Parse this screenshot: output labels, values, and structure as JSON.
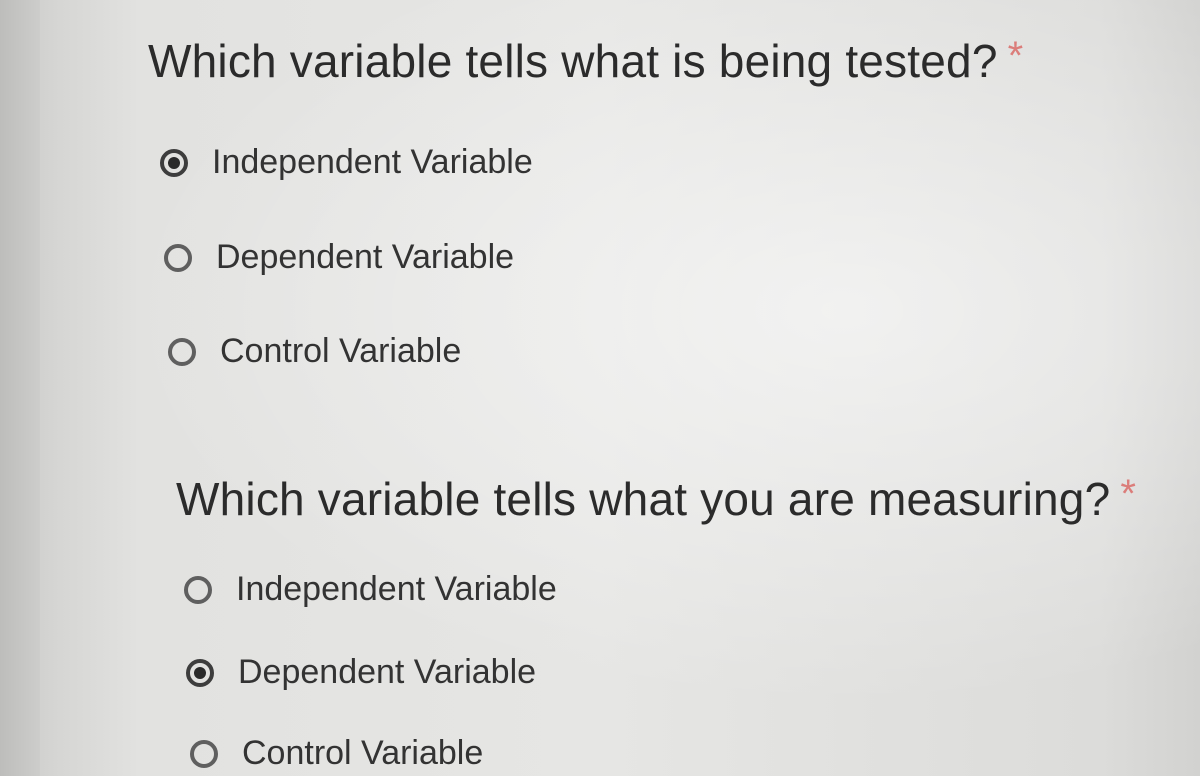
{
  "questions": [
    {
      "title": "Which variable tells what is being tested?",
      "required_mark": "*",
      "options": [
        {
          "label": "Independent Variable",
          "selected": true
        },
        {
          "label": "Dependent Variable",
          "selected": false
        },
        {
          "label": "Control Variable",
          "selected": false
        }
      ]
    },
    {
      "title": "Which variable tells what you are measuring?",
      "required_mark": "*",
      "options": [
        {
          "label": "Independent Variable",
          "selected": false
        },
        {
          "label": "Dependent Variable",
          "selected": true
        },
        {
          "label": "Control Variable",
          "selected": false
        }
      ]
    }
  ]
}
